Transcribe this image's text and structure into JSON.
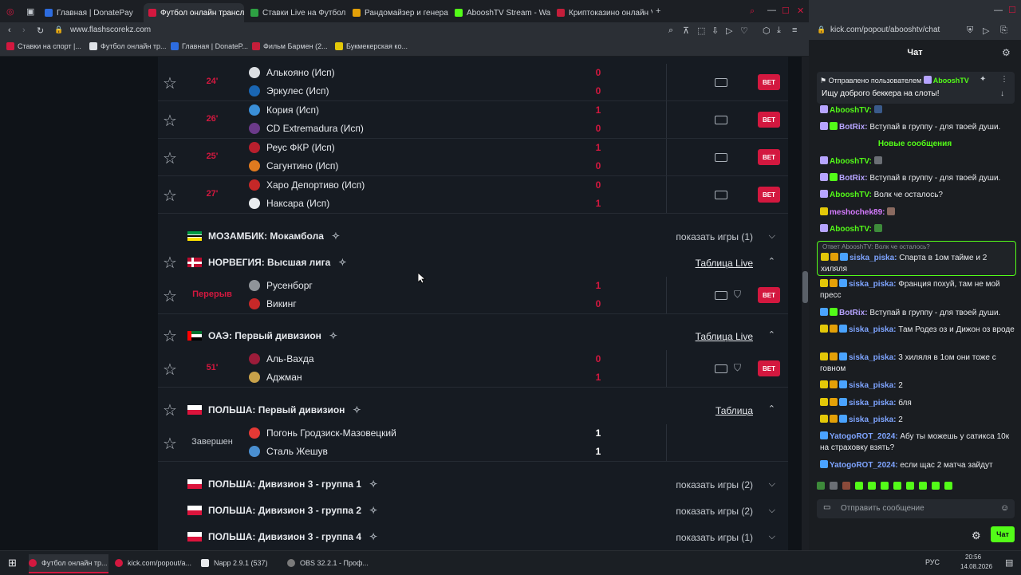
{
  "browser": {
    "tabs": [
      {
        "label": "Главная | DonatePay",
        "color": "#2d6cdf"
      },
      {
        "label": "Футбол онлайн трансляц",
        "color": "#d3183f"
      },
      {
        "label": "Ставки Live на Футбол - С",
        "color": "#2ea043"
      },
      {
        "label": "Рандомайзер и генератор",
        "color": "#e3a008"
      },
      {
        "label": "AbooshTV Stream - Watch",
        "color": "#53fc18"
      },
      {
        "label": "Криптоказино онлайн VA",
        "color": "#c41e3a"
      }
    ],
    "url": "www.flashscorekz.com",
    "bookmarks": [
      "Ставки на спорт |...",
      "Футбол онлайн тр...",
      "Главная | DonateP...",
      "Фильм Бармен (2...",
      "Букмекерская ко..."
    ]
  },
  "matches": [
    {
      "time": "24'",
      "home": "Алькояно (Исп)",
      "away": "Эркулес (Исп)",
      "home_score": "0",
      "away_score": "0",
      "bet": "BET"
    },
    {
      "time": "26'",
      "home": "Кория (Исп)",
      "away": "CD Extremadura (Исп)",
      "home_score": "1",
      "away_score": "0",
      "bet": "BET"
    },
    {
      "time": "25'",
      "home": "Реус ФКР (Исп)",
      "away": "Сагунтино (Исп)",
      "home_score": "1",
      "away_score": "0",
      "bet": "BET"
    },
    {
      "time": "27'",
      "home": "Харо Депортиво (Исп)",
      "away": "Наксара (Исп)",
      "home_score": "0",
      "away_score": "1",
      "bet": "BET"
    }
  ],
  "leagues": {
    "mozambique": {
      "name": "МОЗАМБИК: Мокамбола",
      "action": "показать игры (1)"
    },
    "norway": {
      "name": "НОРВЕГИЯ: Высшая лига",
      "action": "Таблица Live",
      "match": {
        "time": "Перерыв",
        "home": "Русенборг",
        "away": "Викинг",
        "home_score": "1",
        "away_score": "0",
        "bet": "BET"
      }
    },
    "uae": {
      "name": "ОАЭ: Первый дивизион",
      "action": "Таблица Live",
      "match": {
        "time": "51'",
        "home": "Аль-Вахда",
        "away": "Аджман",
        "home_score": "0",
        "away_score": "1",
        "bet": "BET"
      }
    },
    "poland1": {
      "name": "ПОЛЬША: Первый дивизион",
      "action": "Таблица",
      "match": {
        "time": "Завершен",
        "home": "Погонь Гродзиск-Мазовецкий",
        "away": "Сталь Жешув",
        "home_score": "1",
        "away_score": "1"
      }
    },
    "poland3a": {
      "name": "ПОЛЬША: Дивизион 3 - группа 1",
      "action": "показать игры (2)"
    },
    "poland3b": {
      "name": "ПОЛЬША: Дивизион 3 - группа 2",
      "action": "показать игры (2)"
    },
    "poland3c": {
      "name": "ПОЛЬША: Дивизион 3 - группа 4",
      "action": "показать игры (1)"
    }
  },
  "chat_window": {
    "url": "kick.com/popout/abooshtv/chat",
    "title": "Чат",
    "pinned_by": "Отправлено пользователем",
    "pinned_user": "AbooshTV",
    "pinned_text": "Ищу доброго беккера на слоты!",
    "new_messages": "Новые сообщения",
    "reply_header": "Ответ AbooshTV: Волк че осталось?",
    "messages": [
      {
        "user": "AbooshTV:",
        "text": ""
      },
      {
        "user": "BotRix:",
        "text": "Вступай в группу - для твоей души."
      },
      {
        "user": "AbooshTV:",
        "text": ""
      },
      {
        "user": "BotRix:",
        "text": "Вступай в группу - для твоей души."
      },
      {
        "user": "AbooshTV:",
        "text": "Волк че осталось?"
      },
      {
        "user": "meshochek89:",
        "text": ""
      },
      {
        "user": "AbooshTV:",
        "text": ""
      },
      {
        "user": "siska_piska:",
        "text": "Спарта в 1ом тайме и 2 хиляля"
      },
      {
        "user": "siska_piska:",
        "text": "Франция похуй, там не мой пресс"
      },
      {
        "user": "BotRix:",
        "text": "Вступай в группу - для твоей души."
      },
      {
        "user": "siska_piska:",
        "text": "Там Родез оз и Дижон оз вроде"
      },
      {
        "user": "siska_piska:",
        "text": "3 хиляля в 1ом они тоже с говном"
      },
      {
        "user": "siska_piska:",
        "text": "2"
      },
      {
        "user": "siska_piska:",
        "text": "бля"
      },
      {
        "user": "siska_piska:",
        "text": "2"
      },
      {
        "user": "YatogoROT_2024:",
        "text": "Абу ты можешь у сатикса 10к на страховку взять?"
      },
      {
        "user": "YatogoROT_2024:",
        "text": "если щас 2 матча зайдут"
      }
    ],
    "input_placeholder": "Отправить сообщение",
    "send_label": "Чат"
  },
  "taskbar": {
    "items": [
      "Футбол онлайн тр...",
      "kick.com/popout/a...",
      "Napp 2.9.1 (537)",
      "OBS 32.2.1 - Проф..."
    ],
    "lang": "РУС",
    "time": "20:56",
    "date": "14.08.2026"
  }
}
